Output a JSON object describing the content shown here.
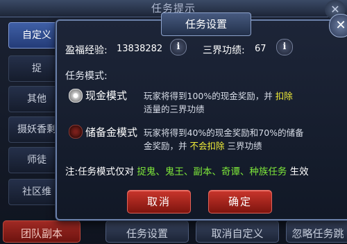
{
  "background": {
    "window_title": "任务提示",
    "side_tabs": [
      "自定义",
      "捉",
      "其他",
      "摄妖香剩",
      "师徒",
      "社区维"
    ],
    "bottom_buttons": [
      "团队副本",
      "任务设置",
      "取消自定义",
      "忽略任务跳"
    ]
  },
  "dialog": {
    "title": "任务设置",
    "exp_label": "盈福经验:",
    "exp_value": "13838282",
    "merit_label": "三界功绩:",
    "merit_value": "67",
    "info_glyph": "i",
    "mode_label": "任务模式:",
    "modes": [
      {
        "name": "现金模式",
        "selected": true,
        "desc_1": "玩家将得到100%的现金奖励，并",
        "desc_hl": "扣除",
        "desc_2": "适量的三界功绩"
      },
      {
        "name": "储备金模式",
        "selected": false,
        "desc_1": "玩家将得到40%的现金奖励和70%的储备",
        "desc_2": "金奖励，并",
        "desc_hl": "不会扣除",
        "desc_3": "三界功绩"
      }
    ],
    "note_prefix": "注:任务模式仅对",
    "note_tasks": "捉鬼、鬼王、副本、奇谭、种族任务",
    "note_suffix": "生效",
    "cancel_label": "取消",
    "confirm_label": "确定"
  },
  "colors": {
    "highlight_yellow": "#f0ec38",
    "highlight_green": "#7ee83a",
    "button_red": "#c9362c"
  }
}
